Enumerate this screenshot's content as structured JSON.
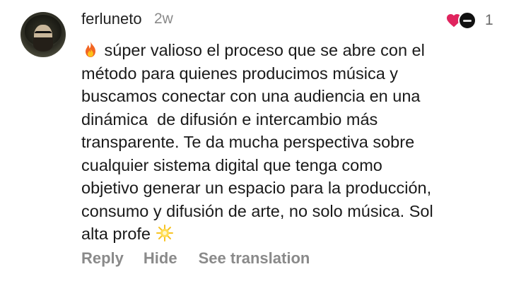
{
  "comment": {
    "author": "ferluneto",
    "age": "2w",
    "like_count": "1",
    "lines": [
      "súper valioso el proceso que se abre con el",
      "método para quienes producimos música y",
      "buscamos conectar con una audiencia en una",
      "dinámica  de difusión e intercambio más",
      "transparente. Te da mucha perspectiva sobre",
      "cualquier sistema digital que tenga como",
      "objetivo generar un espacio para la producción,",
      "consumo y difusión de arte, no solo música. Sol",
      "alta profe"
    ],
    "leading_emoji": "fire-emoji",
    "trailing_emoji": "sparkle-emoji"
  },
  "actions": {
    "reply": "Reply",
    "hide": "Hide",
    "translate": "See translation"
  },
  "colors": {
    "heart": "#e0245e",
    "muted": "#8a8a8a"
  }
}
